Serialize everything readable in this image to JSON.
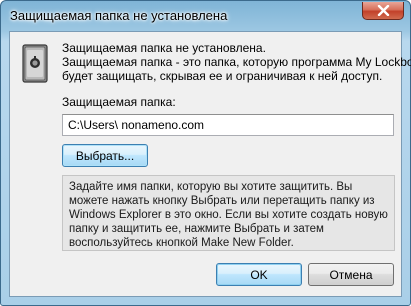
{
  "window": {
    "title": "Защищаемая папка не установлена"
  },
  "message": {
    "line1": "Защищаемая папка не установлена.",
    "line2": "Защищаемая папка - это папка, которую программа My Lockbox",
    "line3": "будет защищать, скрывая ее и ограничивая к ней доступ."
  },
  "folder": {
    "label": "Защищаемая папка:",
    "value": "C:\\Users\\ nonameno.com"
  },
  "buttons": {
    "browse": "Выбрать...",
    "ok": "OK",
    "cancel": "Отмена"
  },
  "hint": {
    "line1": "Задайте имя папки, которую вы хотите защитить. Вы",
    "line2": "можете нажать кнопку Выбрать или перетащить папку из",
    "line3": "Windows Explorer в это окно. Если вы хотите создать новую",
    "line4": "папку и защитить ее, нажмите Выбрать и затем",
    "line5": "воспользуйтесь кнопкой Make New Folder."
  },
  "icons": {
    "app": "lockbox-safe-icon",
    "close": "close-icon"
  }
}
